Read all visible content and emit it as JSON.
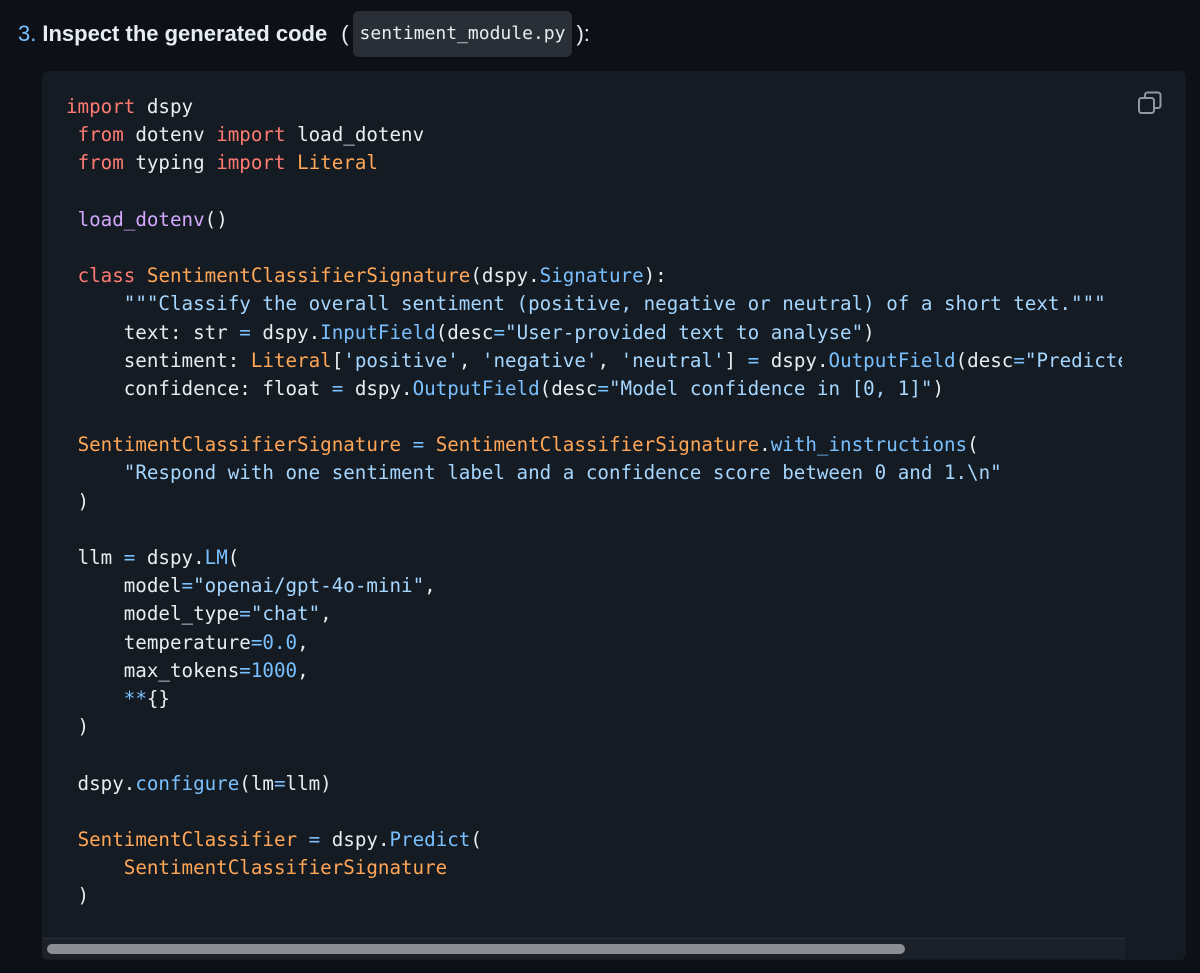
{
  "heading": {
    "number": "3.",
    "title": "Inspect the generated code",
    "open_paren": "(",
    "filename": "sentiment_module.py",
    "close_paren": "):"
  },
  "copy_icon": "copy-icon",
  "colors": {
    "page_bg": "#0d1117",
    "code_bg": "#151b23",
    "keyword": "#ff7b72",
    "class_name": "#ffa657",
    "function": "#d2a8ff",
    "attribute": "#79c0ff",
    "string": "#a5d6ff",
    "text": "#e6edf3"
  },
  "code": {
    "lines": [
      [
        [
          "kw",
          "import"
        ],
        [
          "plain",
          " dspy"
        ]
      ],
      [
        [
          "plain",
          " "
        ],
        [
          "kw",
          "from"
        ],
        [
          "plain",
          " dotenv "
        ],
        [
          "kw",
          "import"
        ],
        [
          "plain",
          " load_dotenv"
        ]
      ],
      [
        [
          "plain",
          " "
        ],
        [
          "kw",
          "from"
        ],
        [
          "plain",
          " typing "
        ],
        [
          "kw",
          "import"
        ],
        [
          "plain",
          " "
        ],
        [
          "cls",
          "Literal"
        ]
      ],
      [],
      [
        [
          "plain",
          " "
        ],
        [
          "fn",
          "load_dotenv"
        ],
        [
          "plain",
          "()"
        ]
      ],
      [],
      [
        [
          "plain",
          " "
        ],
        [
          "kw",
          "class"
        ],
        [
          "plain",
          " "
        ],
        [
          "cls",
          "SentimentClassifierSignature"
        ],
        [
          "plain",
          "(dspy."
        ],
        [
          "attr",
          "Signature"
        ],
        [
          "plain",
          "):"
        ]
      ],
      [
        [
          "plain",
          "     "
        ],
        [
          "str",
          "\"\"\"Classify the overall sentiment (positive, negative or neutral) of a short text.\"\"\""
        ]
      ],
      [
        [
          "plain",
          "     text: str "
        ],
        [
          "op",
          "="
        ],
        [
          "plain",
          " dspy."
        ],
        [
          "attr",
          "InputField"
        ],
        [
          "plain",
          "(desc"
        ],
        [
          "op",
          "="
        ],
        [
          "str",
          "\"User-provided text to analyse\""
        ],
        [
          "plain",
          ")"
        ]
      ],
      [
        [
          "plain",
          "     sentiment: "
        ],
        [
          "cls",
          "Literal"
        ],
        [
          "plain",
          "["
        ],
        [
          "str",
          "'positive'"
        ],
        [
          "plain",
          ", "
        ],
        [
          "str",
          "'negative'"
        ],
        [
          "plain",
          ", "
        ],
        [
          "str",
          "'neutral'"
        ],
        [
          "plain",
          "] "
        ],
        [
          "op",
          "="
        ],
        [
          "plain",
          " dspy."
        ],
        [
          "attr",
          "OutputField"
        ],
        [
          "plain",
          "(desc"
        ],
        [
          "op",
          "="
        ],
        [
          "str",
          "\"Predicted sentiment label\""
        ],
        [
          "plain",
          ")"
        ]
      ],
      [
        [
          "plain",
          "     confidence: float "
        ],
        [
          "op",
          "="
        ],
        [
          "plain",
          " dspy."
        ],
        [
          "attr",
          "OutputField"
        ],
        [
          "plain",
          "(desc"
        ],
        [
          "op",
          "="
        ],
        [
          "str",
          "\"Model confidence in [0, 1]\""
        ],
        [
          "plain",
          ")"
        ]
      ],
      [],
      [
        [
          "plain",
          " "
        ],
        [
          "cls",
          "SentimentClassifierSignature"
        ],
        [
          "plain",
          " "
        ],
        [
          "op",
          "="
        ],
        [
          "plain",
          " "
        ],
        [
          "cls",
          "SentimentClassifierSignature"
        ],
        [
          "plain",
          "."
        ],
        [
          "attr",
          "with_instructions"
        ],
        [
          "plain",
          "("
        ]
      ],
      [
        [
          "plain",
          "     "
        ],
        [
          "str",
          "\"Respond with one sentiment label and a confidence score between 0 and 1.\\n\""
        ]
      ],
      [
        [
          "plain",
          " )"
        ]
      ],
      [],
      [
        [
          "plain",
          " llm "
        ],
        [
          "op",
          "="
        ],
        [
          "plain",
          " dspy."
        ],
        [
          "attr",
          "LM"
        ],
        [
          "plain",
          "("
        ]
      ],
      [
        [
          "plain",
          "     model"
        ],
        [
          "op",
          "="
        ],
        [
          "str",
          "\"openai/gpt-4o-mini\""
        ],
        [
          "plain",
          ","
        ]
      ],
      [
        [
          "plain",
          "     model_type"
        ],
        [
          "op",
          "="
        ],
        [
          "str",
          "\"chat\""
        ],
        [
          "plain",
          ","
        ]
      ],
      [
        [
          "plain",
          "     temperature"
        ],
        [
          "op",
          "="
        ],
        [
          "num",
          "0.0"
        ],
        [
          "plain",
          ","
        ]
      ],
      [
        [
          "plain",
          "     max_tokens"
        ],
        [
          "op",
          "="
        ],
        [
          "num",
          "1000"
        ],
        [
          "plain",
          ","
        ]
      ],
      [
        [
          "plain",
          "     "
        ],
        [
          "op",
          "**"
        ],
        [
          "plain",
          "{}"
        ]
      ],
      [
        [
          "plain",
          " )"
        ]
      ],
      [],
      [
        [
          "plain",
          " dspy."
        ],
        [
          "attr",
          "configure"
        ],
        [
          "plain",
          "(lm"
        ],
        [
          "op",
          "="
        ],
        [
          "plain",
          "llm)"
        ]
      ],
      [],
      [
        [
          "plain",
          " "
        ],
        [
          "cls",
          "SentimentClassifier"
        ],
        [
          "plain",
          " "
        ],
        [
          "op",
          "="
        ],
        [
          "plain",
          " dspy."
        ],
        [
          "attr",
          "Predict"
        ],
        [
          "plain",
          "("
        ]
      ],
      [
        [
          "plain",
          "     "
        ],
        [
          "cls",
          "SentimentClassifierSignature"
        ]
      ],
      [
        [
          "plain",
          " )"
        ]
      ]
    ]
  },
  "scroll": {
    "horizontal_position": 0,
    "visible_fraction": 0.8
  }
}
